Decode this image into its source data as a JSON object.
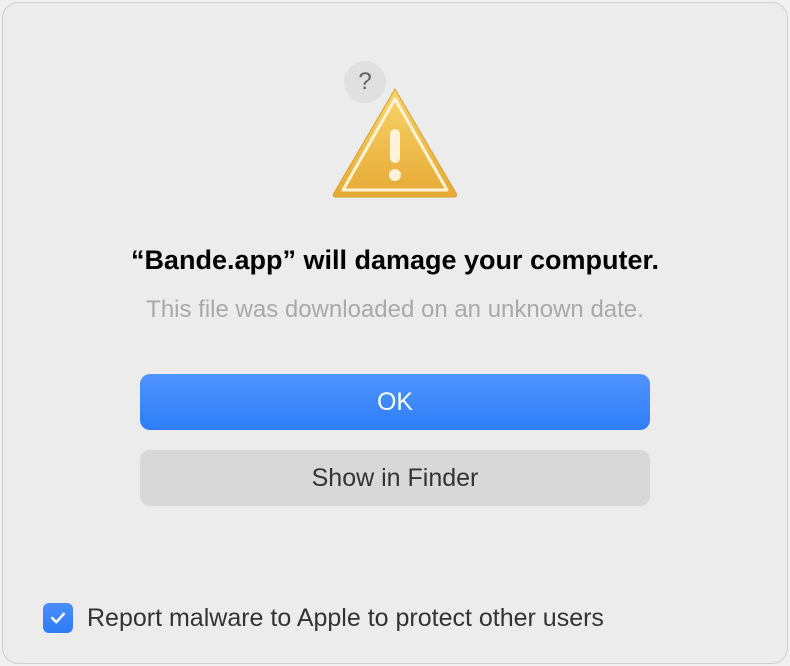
{
  "dialog": {
    "title": "“Bande.app” will damage your computer.",
    "subtitle": "This file was downloaded on an unknown date.",
    "help_label": "?",
    "buttons": {
      "ok": "OK",
      "show_in_finder": "Show in Finder"
    },
    "checkbox": {
      "checked": true,
      "label": "Report malware to Apple to protect other users"
    }
  }
}
